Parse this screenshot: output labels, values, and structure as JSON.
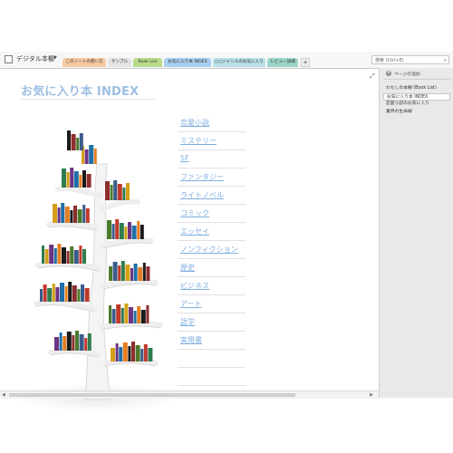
{
  "notebook": {
    "title": "デジタル本棚"
  },
  "tabs": [
    {
      "label": "このノートの使い方"
    },
    {
      "label": "サンプル"
    },
    {
      "label": "Book List"
    },
    {
      "label": "お気に入り本 INDEX"
    },
    {
      "label": "○○ジャンルのお気に入り"
    },
    {
      "label": "レビュー詳細"
    }
  ],
  "tab_add_label": "+",
  "search": {
    "placeholder": "検索 (Ctrl+E)"
  },
  "page": {
    "title": "お気に入り本 INDEX",
    "genres": [
      "恋愛小説",
      "ミステリー",
      "SF",
      "ファンタジー",
      "ライトノベル",
      "コミック",
      "エッセイ",
      "ノンフィクション",
      "歴史",
      "ビジネス",
      "アート",
      "語学",
      "実用書",
      "",
      ""
    ]
  },
  "pages_panel": {
    "add_page_label": "ページの追加",
    "items": [
      {
        "label": "わたしの本棚 (Book List)",
        "selected": false
      },
      {
        "label": "お気に入り本 INDEX",
        "selected": true
      },
      {
        "label": "恋愛小説のお気に入り",
        "selected": false
      },
      {
        "label": "業界の生命線",
        "selected": false
      }
    ]
  },
  "colors": {
    "title": "#9dbfe1",
    "link": "#7faee0",
    "book_colors": [
      "#3b5b8c",
      "#c0392b",
      "#2e7d4f",
      "#d4a017",
      "#6c3483",
      "#1f6fa8",
      "#e67e22",
      "#1a1a1a",
      "#8e2d2d",
      "#4a7a2c"
    ]
  }
}
